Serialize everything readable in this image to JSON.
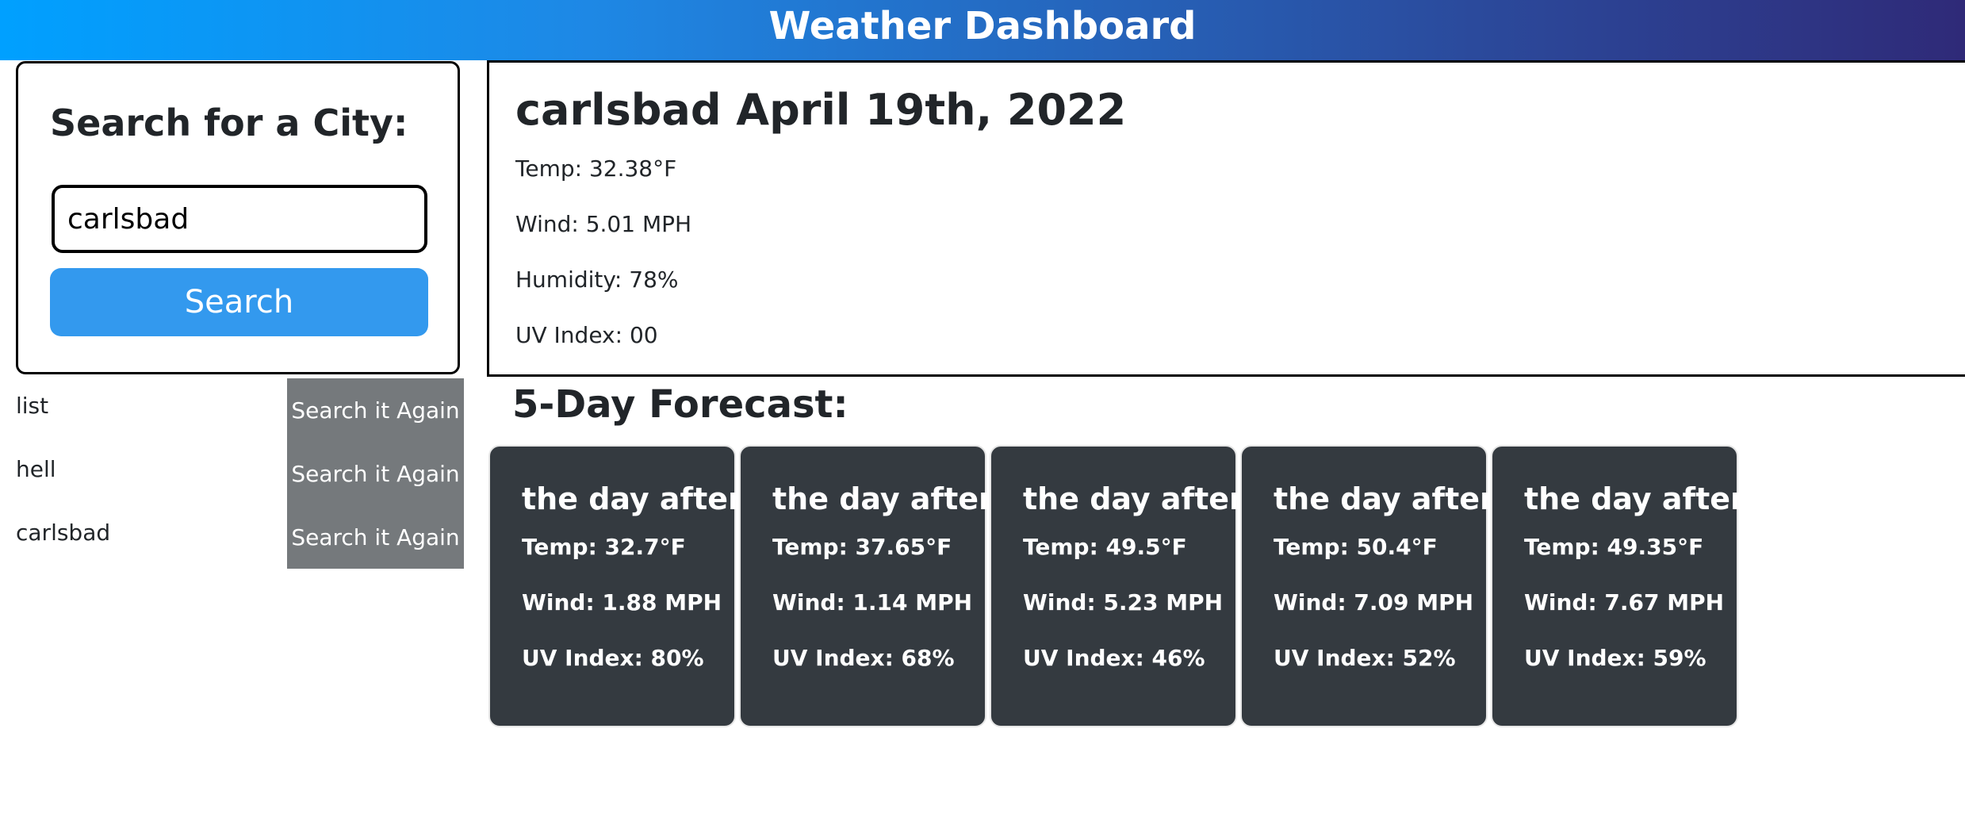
{
  "header": {
    "title": "Weather Dashboard"
  },
  "search": {
    "heading": "Search for a City:",
    "input_value": "carlsbad",
    "button_label": "Search"
  },
  "history": [
    {
      "city": "list",
      "button_label": "Search it Again"
    },
    {
      "city": "hell",
      "button_label": "Search it Again"
    },
    {
      "city": "carlsbad",
      "button_label": "Search it Again"
    }
  ],
  "current": {
    "title": "carlsbad April 19th, 2022",
    "temp": "Temp: 32.38°F",
    "wind": "Wind: 5.01 MPH",
    "humidity": "Humidity: 78%",
    "uv": "UV Index: 00"
  },
  "forecast": {
    "heading": "5-Day Forecast:",
    "cards": [
      {
        "title": "the day after",
        "temp": "Temp: 32.7°F",
        "wind": "Wind: 1.88 MPH",
        "uv": "UV Index: 80%"
      },
      {
        "title": "the day after",
        "temp": "Temp: 37.65°F",
        "wind": "Wind: 1.14 MPH",
        "uv": "UV Index: 68%"
      },
      {
        "title": "the day after",
        "temp": "Temp: 49.5°F",
        "wind": "Wind: 5.23 MPH",
        "uv": "UV Index: 46%"
      },
      {
        "title": "the day after",
        "temp": "Temp: 50.4°F",
        "wind": "Wind: 7.09 MPH",
        "uv": "UV Index: 52%"
      },
      {
        "title": "the day after",
        "temp": "Temp: 49.35°F",
        "wind": "Wind: 7.67 MPH",
        "uv": "UV Index: 59%"
      }
    ]
  },
  "colors": {
    "header_gradient_start": "#00a0ff",
    "header_gradient_end": "#2f2a78",
    "search_button": "#3399ee",
    "history_button": "#75797c",
    "forecast_card": "#343a40"
  }
}
